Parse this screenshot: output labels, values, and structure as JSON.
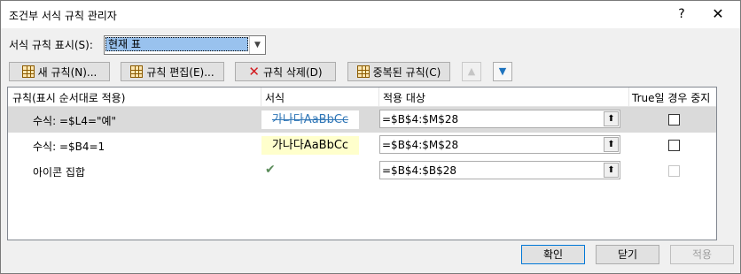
{
  "window": {
    "title": "조건부 서식 규칙 관리자",
    "help": "?",
    "close": "✕"
  },
  "show_rules": {
    "label": "서식 규칙 표시(S):",
    "value": "현재 표"
  },
  "toolbar": {
    "new_rule": "새 규칙(N)...",
    "edit_rule": "규칙 편집(E)...",
    "delete_rule": "규칙 삭제(D)",
    "duplicate_rule": "중복된 규칙(C)",
    "move_up_icon": "arrow-up-icon",
    "move_down_icon": "arrow-down-icon"
  },
  "table": {
    "headers": [
      "규칙(표시 순서대로 적용)",
      "서식",
      "적용 대상",
      "True일 경우 중지"
    ],
    "rows": [
      {
        "rule": "수식: =$L4=\"예\"",
        "preview": "가나다AaBbCc",
        "applies_to": "=$B$4:$M$28",
        "stop_if_true": false,
        "selected": true
      },
      {
        "rule": "수식: =$B4=1",
        "preview": "가나다AaBbCc",
        "applies_to": "=$B$4:$M$28",
        "stop_if_true": false,
        "selected": false
      },
      {
        "rule": "아이콘 집합",
        "preview_icon": "checkmark-icon",
        "applies_to": "=$B$4:$B$28",
        "stop_if_true": false,
        "selected": false
      }
    ]
  },
  "buttons": {
    "ok": "확인",
    "close": "닫기",
    "apply": "적용"
  }
}
